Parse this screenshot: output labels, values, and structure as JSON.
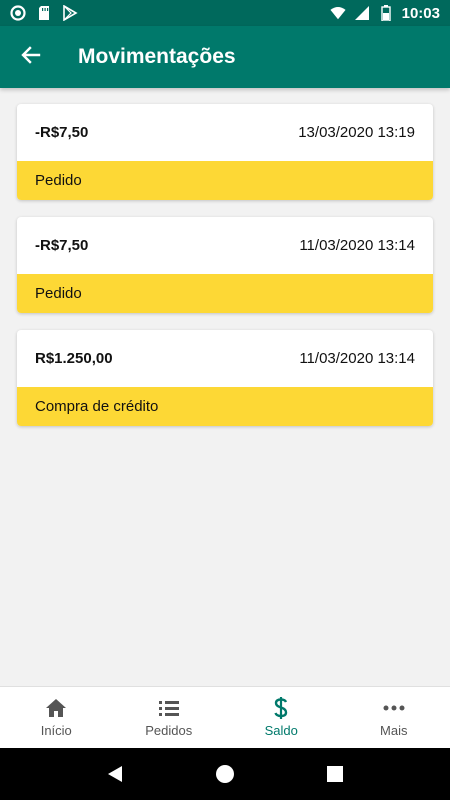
{
  "status_bar": {
    "time": "10:03",
    "icons": [
      "record-icon",
      "sd-card-icon",
      "play-store-icon",
      "wifi-icon",
      "signal-icon",
      "battery-icon"
    ]
  },
  "app_bar": {
    "title": "Movimentações",
    "back_icon": "arrow-back-icon"
  },
  "transactions": [
    {
      "amount": "-R$7,50",
      "date": "13/03/2020 13:19",
      "description": "Pedido"
    },
    {
      "amount": "-R$7,50",
      "date": "11/03/2020 13:14",
      "description": "Pedido"
    },
    {
      "amount": "R$1.250,00",
      "date": "11/03/2020 13:14",
      "description": "Compra de crédito"
    }
  ],
  "bottom_nav": {
    "items": [
      {
        "label": "Início",
        "icon": "home-icon",
        "active": false
      },
      {
        "label": "Pedidos",
        "icon": "list-icon",
        "active": false
      },
      {
        "label": "Saldo",
        "icon": "dollar-icon",
        "active": true
      },
      {
        "label": "Mais",
        "icon": "more-icon",
        "active": false
      }
    ]
  },
  "colors": {
    "primary": "#00796b",
    "primary_dark": "#00695c",
    "card_footer": "#fdd835",
    "background": "#f2f2f2"
  }
}
